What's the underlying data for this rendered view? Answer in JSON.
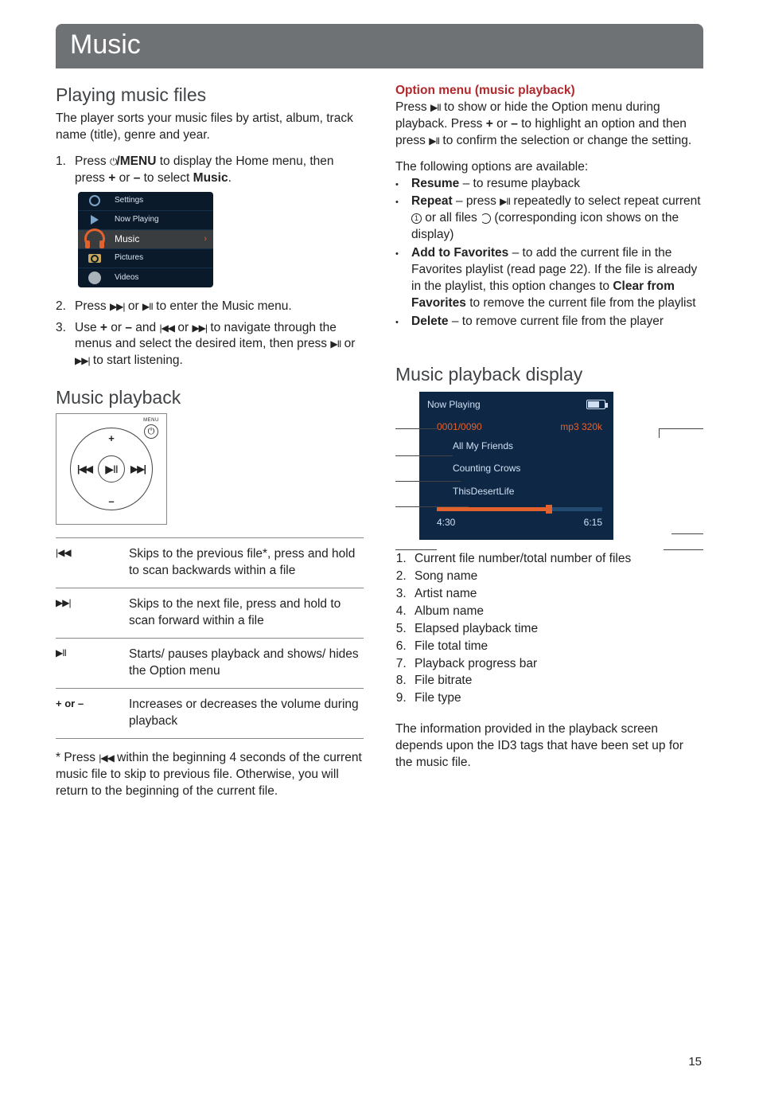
{
  "banner_title": "Music",
  "left": {
    "h_playing_files": "Playing music files",
    "intro": "The player sorts your music files by artist, album, track name (title), genre and year.",
    "step1_a": "Press ",
    "step1_b": "/MENU",
    "step1_c": " to display the Home menu, then press ",
    "step1_d": " or ",
    "step1_e": " to select ",
    "step1_f": "Music",
    "step1_g": ".",
    "plus": "+",
    "minus": "–",
    "menu_items": {
      "settings": "Settings",
      "now_playing": "Now Playing",
      "music": "Music",
      "pictures": "Pictures",
      "videos": "Videos"
    },
    "step2": "Press     or     to enter the Music menu.",
    "step3": "Use + or – and     or     to navigate through the menus and select the desired item, then press     or     to start listening.",
    "h_playback": "Music playback",
    "pad": {
      "plus": "+",
      "minus": "–",
      "menu": "MENU"
    },
    "controls": {
      "prev": "Skips to the previous file*, press and hold to scan backwards within a file",
      "next": "Skips to the next file, press and hold to scan forward within a file",
      "play": "Starts/ pauses playback and shows/ hides the Option menu",
      "vol_key": "+ or –",
      "vol": "Increases or decreases the volume during playback"
    },
    "footnote": "* Press     within the beginning 4 seconds of the current music file to skip to previous file. Otherwise, you will return to the beginning of the current file."
  },
  "right": {
    "h_option": "Option menu (music playback)",
    "opt_p1": "Press     to show or hide the Option menu during playback. Press + or – to highlight an option and then press     to confirm the selection or change the setting.",
    "opt_avail": "The following options are available:",
    "resume_b": "Resume",
    "resume_t": " – to resume playback",
    "repeat_b": "Repeat",
    "repeat_t": " – press     repeatedly to select repeat current      or all files      (corresponding icon shows on the display)",
    "fav_b": "Add to Favorites",
    "fav_t1": " – to add the current file in the Favorites playlist (read page 22). If the file is already in the playlist, this option changes to ",
    "fav_b2": "Clear from Favorites",
    "fav_t2": " to remove the current file from the playlist",
    "del_b": "Delete",
    "del_t": " – to remove current file from the player",
    "h_display": "Music playback display",
    "np": {
      "header": "Now Playing",
      "count": "0001/0090",
      "codec": "mp3 320k",
      "song": "All My Friends",
      "artist": "Counting Crows",
      "album": "ThisDesertLife",
      "elapsed": "4:30",
      "total": "6:15"
    },
    "legend": {
      "i1": "Current file number/total number of files",
      "i2": "Song name",
      "i3": "Artist name",
      "i4": "Album name",
      "i5": "Elapsed playback time",
      "i6": "File total time",
      "i7": "Playback progress bar",
      "i8": "File bitrate",
      "i9": "File type"
    },
    "closing": "The information provided in the playback screen depends upon the ID3 tags that have been set up for the music file."
  },
  "page_number": "15"
}
